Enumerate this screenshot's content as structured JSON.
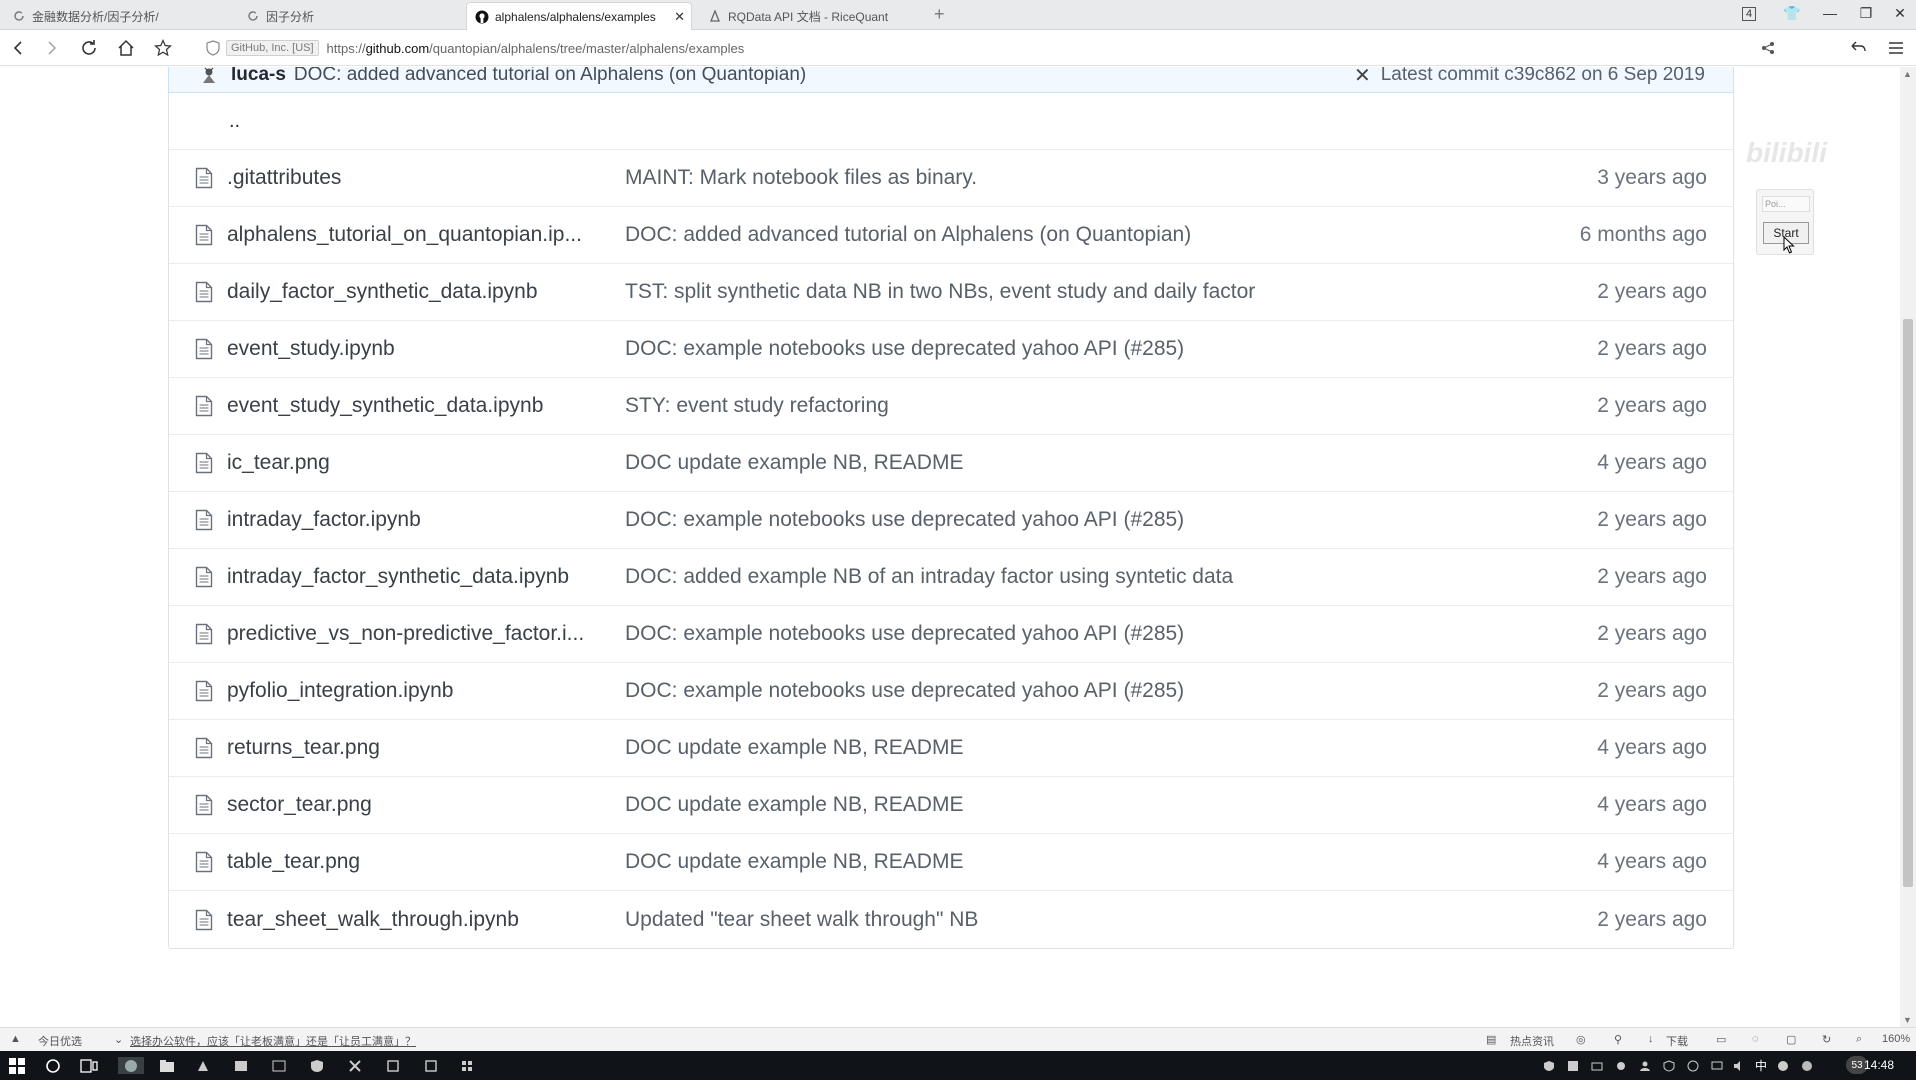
{
  "browser": {
    "tabs": [
      {
        "label": "金融数据分析/因子分析/"
      },
      {
        "label": "因子分析"
      },
      {
        "label": "alphalens/alphalens/examples"
      },
      {
        "label": "RQData API 文档 - RiceQuant"
      }
    ],
    "tab_count": "4",
    "cert_label": "GitHub, Inc. [US]",
    "url": {
      "scheme": "https://",
      "host": "github.com",
      "path": "/quantopian/alphalens/tree/master/alphalens/examples"
    }
  },
  "commit_bar": {
    "author": "luca-s",
    "message": "DOC: added advanced tutorial on Alphalens (on Quantopian)",
    "latest_commit": "Latest commit c39c862 on 6 Sep 2019"
  },
  "file_table": {
    "parent_dir": "..",
    "files": [
      {
        "name": ".gitattributes",
        "message": "MAINT: Mark notebook files as binary.",
        "age": "3 years ago"
      },
      {
        "name": "alphalens_tutorial_on_quantopian.ip...",
        "message": "DOC: added advanced tutorial on Alphalens (on Quantopian)",
        "age": "6 months ago"
      },
      {
        "name": "daily_factor_synthetic_data.ipynb",
        "message": "TST: split synthetic data NB in two NBs, event study and daily factor",
        "age": "2 years ago"
      },
      {
        "name": "event_study.ipynb",
        "message": "DOC: example notebooks use deprecated yahoo API (#285)",
        "age": "2 years ago"
      },
      {
        "name": "event_study_synthetic_data.ipynb",
        "message": "STY: event study refactoring",
        "age": "2 years ago"
      },
      {
        "name": "ic_tear.png",
        "message": "DOC update example NB, README",
        "age": "4 years ago"
      },
      {
        "name": "intraday_factor.ipynb",
        "message": "DOC: example notebooks use deprecated yahoo API (#285)",
        "age": "2 years ago"
      },
      {
        "name": "intraday_factor_synthetic_data.ipynb",
        "message": "DOC: added example NB of an intraday factor using syntetic data",
        "age": "2 years ago"
      },
      {
        "name": "predictive_vs_non-predictive_factor.i...",
        "message": "DOC: example notebooks use deprecated yahoo API (#285)",
        "age": "2 years ago"
      },
      {
        "name": "pyfolio_integration.ipynb",
        "message": "DOC: example notebooks use deprecated yahoo API (#285)",
        "age": "2 years ago"
      },
      {
        "name": "returns_tear.png",
        "message": "DOC update example NB, README",
        "age": "4 years ago"
      },
      {
        "name": "sector_tear.png",
        "message": "DOC update example NB, README",
        "age": "4 years ago"
      },
      {
        "name": "table_tear.png",
        "message": "DOC update example NB, README",
        "age": "4 years ago"
      },
      {
        "name": "tear_sheet_walk_through.ipynb",
        "message": "Updated \"tear sheet walk through\" NB",
        "age": "2 years ago"
      }
    ]
  },
  "widget": {
    "field_text": "Poi...",
    "start_label": "Start"
  },
  "statusbar": {
    "left_label": "今日优选",
    "news": "选择办公软件，应该「让老板满意」还是「让员工满意」？",
    "hot_label": "热点资讯",
    "download_label": "下载",
    "zoom": "160%"
  },
  "taskbar": {
    "ime": "中",
    "badge": "53",
    "clock": "14:48"
  },
  "watermark": "bilibili",
  "colors": {
    "link": "#0366d6",
    "commit_bg": "#f1f8ff",
    "border": "#dfe2e5",
    "taskbar": "#101418"
  }
}
